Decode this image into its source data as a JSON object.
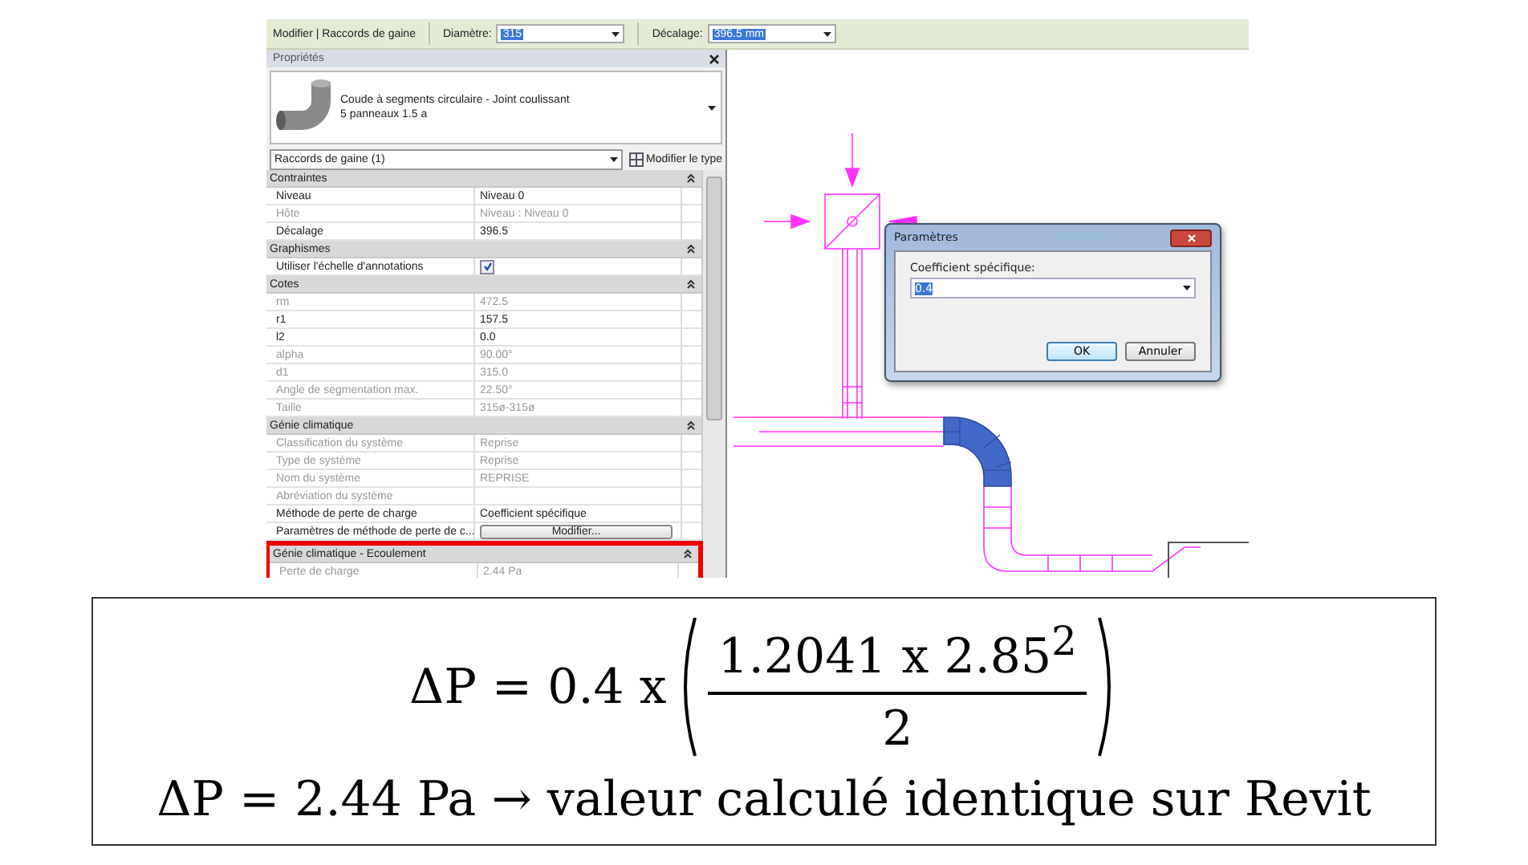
{
  "toolbar": {
    "title": "Modifier | Raccords de gaine",
    "fields": [
      {
        "label": "Diamètre:",
        "value": "315"
      },
      {
        "label": "Décalage:",
        "value": "396.5 mm"
      }
    ]
  },
  "properties": {
    "title": "Propriétés",
    "type_name": "Coude à segments circulaire - Joint coulissant",
    "type_detail": "5 panneaux 1.5 a",
    "selector": "Raccords de gaine (1)",
    "edit_type_button": "Modifier le type",
    "sections": [
      {
        "title": "Contraintes",
        "highlighted": false,
        "rows": [
          {
            "kind": "text",
            "label": "Niveau",
            "value": "Niveau 0",
            "disabled": false
          },
          {
            "kind": "text",
            "label": "Hôte",
            "value": "Niveau : Niveau 0",
            "disabled": true
          },
          {
            "kind": "text",
            "label": "Décalage",
            "value": "396.5",
            "disabled": false
          }
        ]
      },
      {
        "title": "Graphismes",
        "highlighted": false,
        "rows": [
          {
            "kind": "checkbox",
            "label": "Utiliser l'échelle d'annotations",
            "checked": true,
            "disabled": false
          }
        ]
      },
      {
        "title": "Cotes",
        "highlighted": false,
        "rows": [
          {
            "kind": "text",
            "label": "rm",
            "value": "472.5",
            "disabled": true
          },
          {
            "kind": "text",
            "label": "r1",
            "value": "157.5",
            "disabled": false
          },
          {
            "kind": "text",
            "label": "l2",
            "value": "0.0",
            "disabled": false
          },
          {
            "kind": "text",
            "label": "alpha",
            "value": "90.00°",
            "disabled": true
          },
          {
            "kind": "text",
            "label": "d1",
            "value": "315.0",
            "disabled": true
          },
          {
            "kind": "text",
            "label": "Angle de segmentation max.",
            "value": "22.50°",
            "disabled": true
          },
          {
            "kind": "text",
            "label": "Taille",
            "value": "315ø-315ø",
            "disabled": true
          }
        ]
      },
      {
        "title": "Génie climatique",
        "highlighted": false,
        "rows": [
          {
            "kind": "text",
            "label": "Classification du système",
            "value": "Reprise",
            "disabled": true
          },
          {
            "kind": "text",
            "label": "Type de système",
            "value": "Reprise",
            "disabled": true
          },
          {
            "kind": "text",
            "label": "Nom du système",
            "value": "REPRISE",
            "disabled": true
          },
          {
            "kind": "text",
            "label": "Abréviation du système",
            "disabled": true
          },
          {
            "kind": "text",
            "label": "Méthode de perte de charge",
            "value": "Coefficient spécifique",
            "disabled": false
          },
          {
            "kind": "button",
            "label": "Paramètres de méthode de perte de c...",
            "value": "Modifier...",
            "disabled": false
          }
        ]
      },
      {
        "title": "Génie climatique - Ecoulement",
        "highlighted": true,
        "rows": [
          {
            "kind": "text",
            "label": "Perte de charge",
            "value": "2.44 Pa",
            "disabled": true
          }
        ]
      }
    ]
  },
  "dialog": {
    "title": "Paramètres",
    "field_label": "Coefficient spécifique:",
    "value": "0.4",
    "buttons": [
      "OK",
      "Annuler"
    ]
  },
  "formula": {
    "lhs": "ΔP = 0.4 x",
    "numerator": "1.2041 x 2.85$^{2}$",
    "denominator": "2",
    "result": "ΔP = 2.44 Pa → valeur calculé identique sur Revit"
  }
}
